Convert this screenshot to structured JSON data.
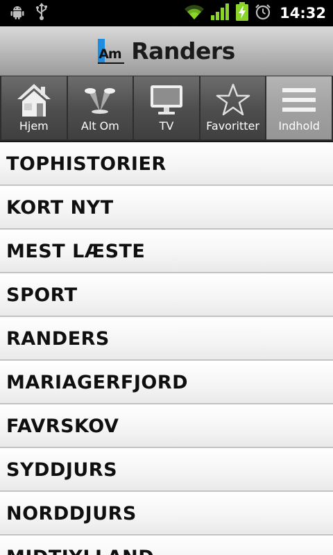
{
  "status_bar": {
    "time": "14:32",
    "icons": [
      "android-debug-icon",
      "usb-icon",
      "wifi-icon",
      "signal-icon",
      "battery-charging-icon",
      "alarm-icon"
    ]
  },
  "header": {
    "logo_mark": "Am",
    "logo_text": "Randers",
    "accent_color": "#1e8de0"
  },
  "tabs": [
    {
      "label": "Hjem",
      "icon": "home-icon",
      "active": false
    },
    {
      "label": "Alt Om",
      "icon": "spotlight-icon",
      "active": false
    },
    {
      "label": "TV",
      "icon": "tv-icon",
      "active": false
    },
    {
      "label": "Favoritter",
      "icon": "star-icon",
      "active": false
    },
    {
      "label": "Indhold",
      "icon": "menu-icon",
      "active": true
    }
  ],
  "sections": [
    "TOPHISTORIER",
    "KORT NYT",
    "MEST LÆSTE",
    "SPORT",
    "RANDERS",
    "MARIAGERFJORD",
    "FAVRSKOV",
    "SYDDJURS",
    "NORDDJURS",
    "MIDTJYLLAND"
  ]
}
